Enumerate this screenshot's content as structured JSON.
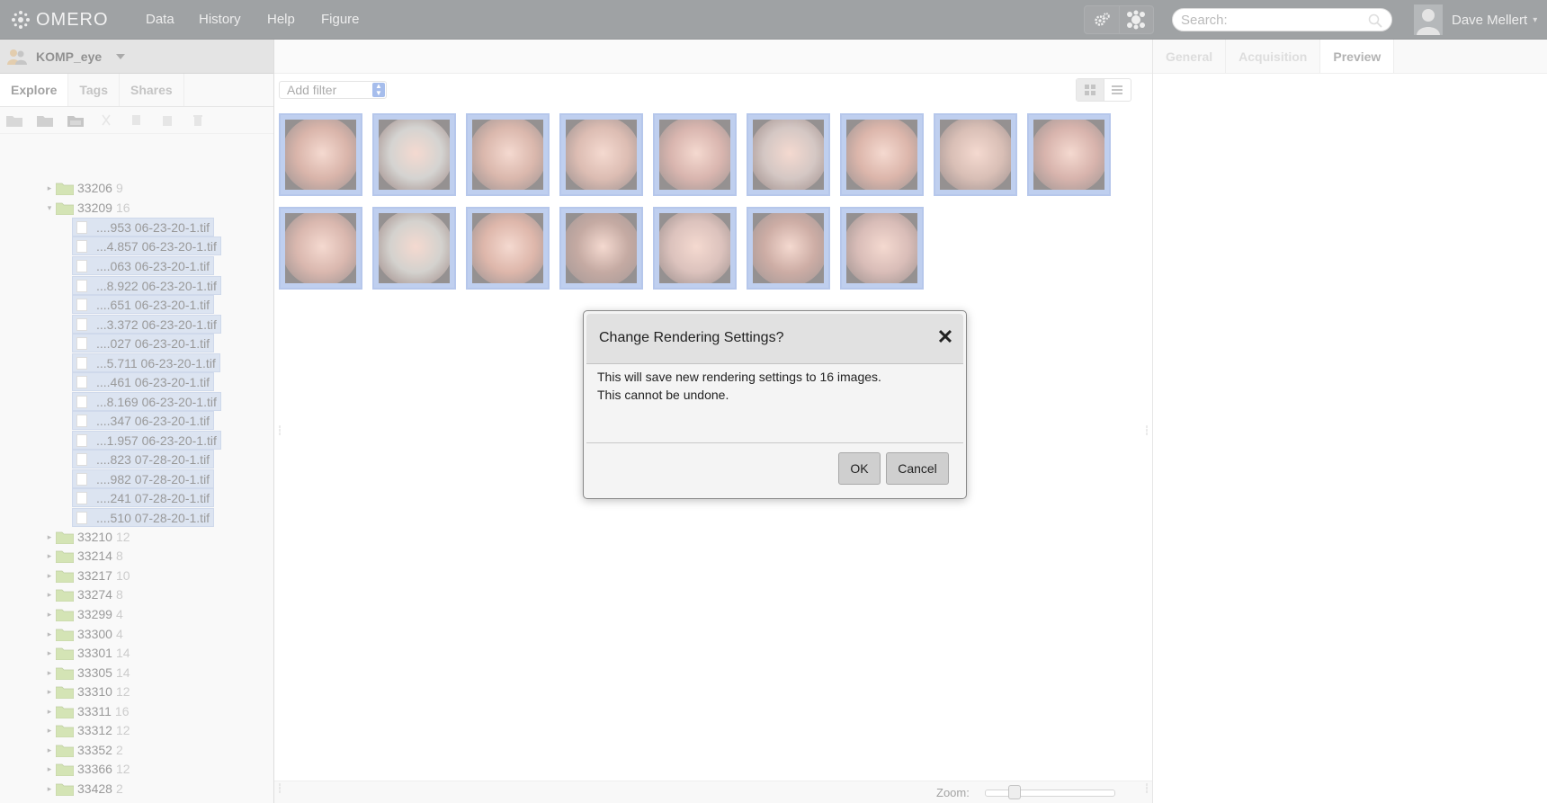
{
  "app": {
    "logo_text": "OMERO",
    "nav": [
      "Data",
      "History",
      "Help",
      "Figure"
    ],
    "search": {
      "placeholder": "Search:"
    },
    "user": {
      "name": "Dave Mellert"
    }
  },
  "left": {
    "group": {
      "name": "KOMP_eye"
    },
    "tabs": [
      "Explore",
      "Tags",
      "Shares"
    ],
    "active_tab": "Explore",
    "toolbar_icons": [
      "new-folder-icon",
      "new-dataset-icon",
      "new-screen-icon",
      "cut-icon",
      "copy-icon",
      "paste-icon",
      "delete-icon"
    ],
    "tree": {
      "top": [
        {
          "name": "33206",
          "count": "9"
        }
      ],
      "open": {
        "name": "33209",
        "count": "16"
      },
      "images": [
        "....953 06-23-20-1.tif",
        "...4.857 06-23-20-1.tif",
        "....063 06-23-20-1.tif",
        "...8.922 06-23-20-1.tif",
        "....651 06-23-20-1.tif",
        "...3.372 06-23-20-1.tif",
        "....027 06-23-20-1.tif",
        "...5.711 06-23-20-1.tif",
        "....461 06-23-20-1.tif",
        "...8.169 06-23-20-1.tif",
        "....347 06-23-20-1.tif",
        "...1.957 06-23-20-1.tif",
        "....823 07-28-20-1.tif",
        "....982 07-28-20-1.tif",
        "....241 07-28-20-1.tif",
        "....510 07-28-20-1.tif"
      ],
      "below": [
        {
          "name": "33210",
          "count": "12"
        },
        {
          "name": "33214",
          "count": "8"
        },
        {
          "name": "33217",
          "count": "10"
        },
        {
          "name": "33274",
          "count": "8"
        },
        {
          "name": "33299",
          "count": "4"
        },
        {
          "name": "33300",
          "count": "4"
        },
        {
          "name": "33301",
          "count": "14"
        },
        {
          "name": "33305",
          "count": "14"
        },
        {
          "name": "33310",
          "count": "12"
        },
        {
          "name": "33311",
          "count": "16"
        },
        {
          "name": "33312",
          "count": "12"
        },
        {
          "name": "33352",
          "count": "2"
        },
        {
          "name": "33366",
          "count": "12"
        },
        {
          "name": "33428",
          "count": "2"
        }
      ]
    }
  },
  "center": {
    "filter": {
      "value": "Add filter"
    },
    "thumbnail_count": 16,
    "zoom_label": "Zoom:",
    "zoom_level": 0.2
  },
  "right": {
    "tabs": [
      "General",
      "Acquisition",
      "Preview"
    ],
    "active_tab": "Preview"
  },
  "dialog": {
    "title": "Change Rendering Settings?",
    "close_glyph": "✕",
    "line1": "This will save new rendering settings to 16 images.",
    "line2": "This cannot be undone.",
    "ok_label": "OK",
    "cancel_label": "Cancel"
  },
  "colors": {
    "topbar": "#3f4448",
    "selection": "#b9c8e3",
    "thumb_border": "#7f9ede",
    "folder": "#a8c86a"
  }
}
